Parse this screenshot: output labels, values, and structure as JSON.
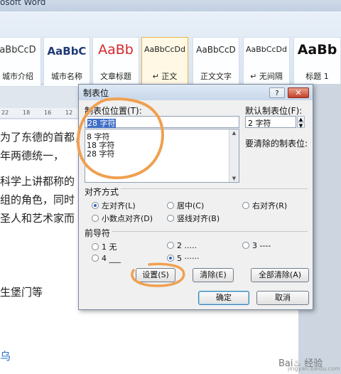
{
  "window_title": "osoft Word",
  "styles": [
    {
      "sample": "aBbCcD",
      "label": "城市介绍"
    },
    {
      "sample": "AaBbC",
      "label": "城市名称"
    },
    {
      "sample": "AaBb",
      "label": "文章标题"
    },
    {
      "sample": "AaBbCcDd",
      "label": "↵ 正文"
    },
    {
      "sample": "AaBbCcD",
      "label": "正文文字"
    },
    {
      "sample": "AaBbCcDd",
      "label": "↵ 无间隔"
    },
    {
      "sample": "AaBb",
      "label": "标题 1"
    }
  ],
  "ruler_marks": [
    "22",
    "18",
    "16",
    "12"
  ],
  "document_lines": [
    "为了东德的首都，",
    "年两德统一，",
    "科学上讲都称的",
    "组的角色，同时",
    "圣人和艺术家而",
    "",
    "生堡门等",
    "乌"
  ],
  "dialog": {
    "title": "制表位",
    "help_label": "?",
    "close_label": "✕",
    "tab_pos_label": "制表位位置(T):",
    "tab_pos_value": "28 字符",
    "tab_list": [
      "8 字符",
      "18 字符",
      "28 字符"
    ],
    "default_tab_label": "默认制表位(F):",
    "default_tab_value": "2 字符",
    "clear_label": "要清除的制表位:",
    "align_label": "对齐方式",
    "align_options": [
      {
        "label": "左对齐(L)",
        "checked": true
      },
      {
        "label": "居中(C)",
        "checked": false
      },
      {
        "label": "右对齐(R)",
        "checked": false
      },
      {
        "label": "小数点对齐(D)",
        "checked": false
      },
      {
        "label": "竖线对齐(B)",
        "checked": false
      }
    ],
    "leader_label": "前导符",
    "leader_options": [
      {
        "label": "1 无",
        "checked": false
      },
      {
        "label": "2 .....",
        "checked": false
      },
      {
        "label": "3 ----",
        "checked": false
      },
      {
        "label": "4 ___",
        "checked": false
      },
      {
        "label": "5 ······",
        "checked": true
      }
    ],
    "buttons": {
      "set": "设置(S)",
      "clear": "清除(E)",
      "clear_all": "全部清除(A)",
      "ok": "确定",
      "cancel": "取消"
    }
  },
  "watermark": {
    "brand": "Bai♨ 经验",
    "url": "jingyan.baidu.com"
  },
  "colors": {
    "annotation": "#f0a050",
    "selection": "#3f6ec6",
    "close": "#c4412b"
  }
}
